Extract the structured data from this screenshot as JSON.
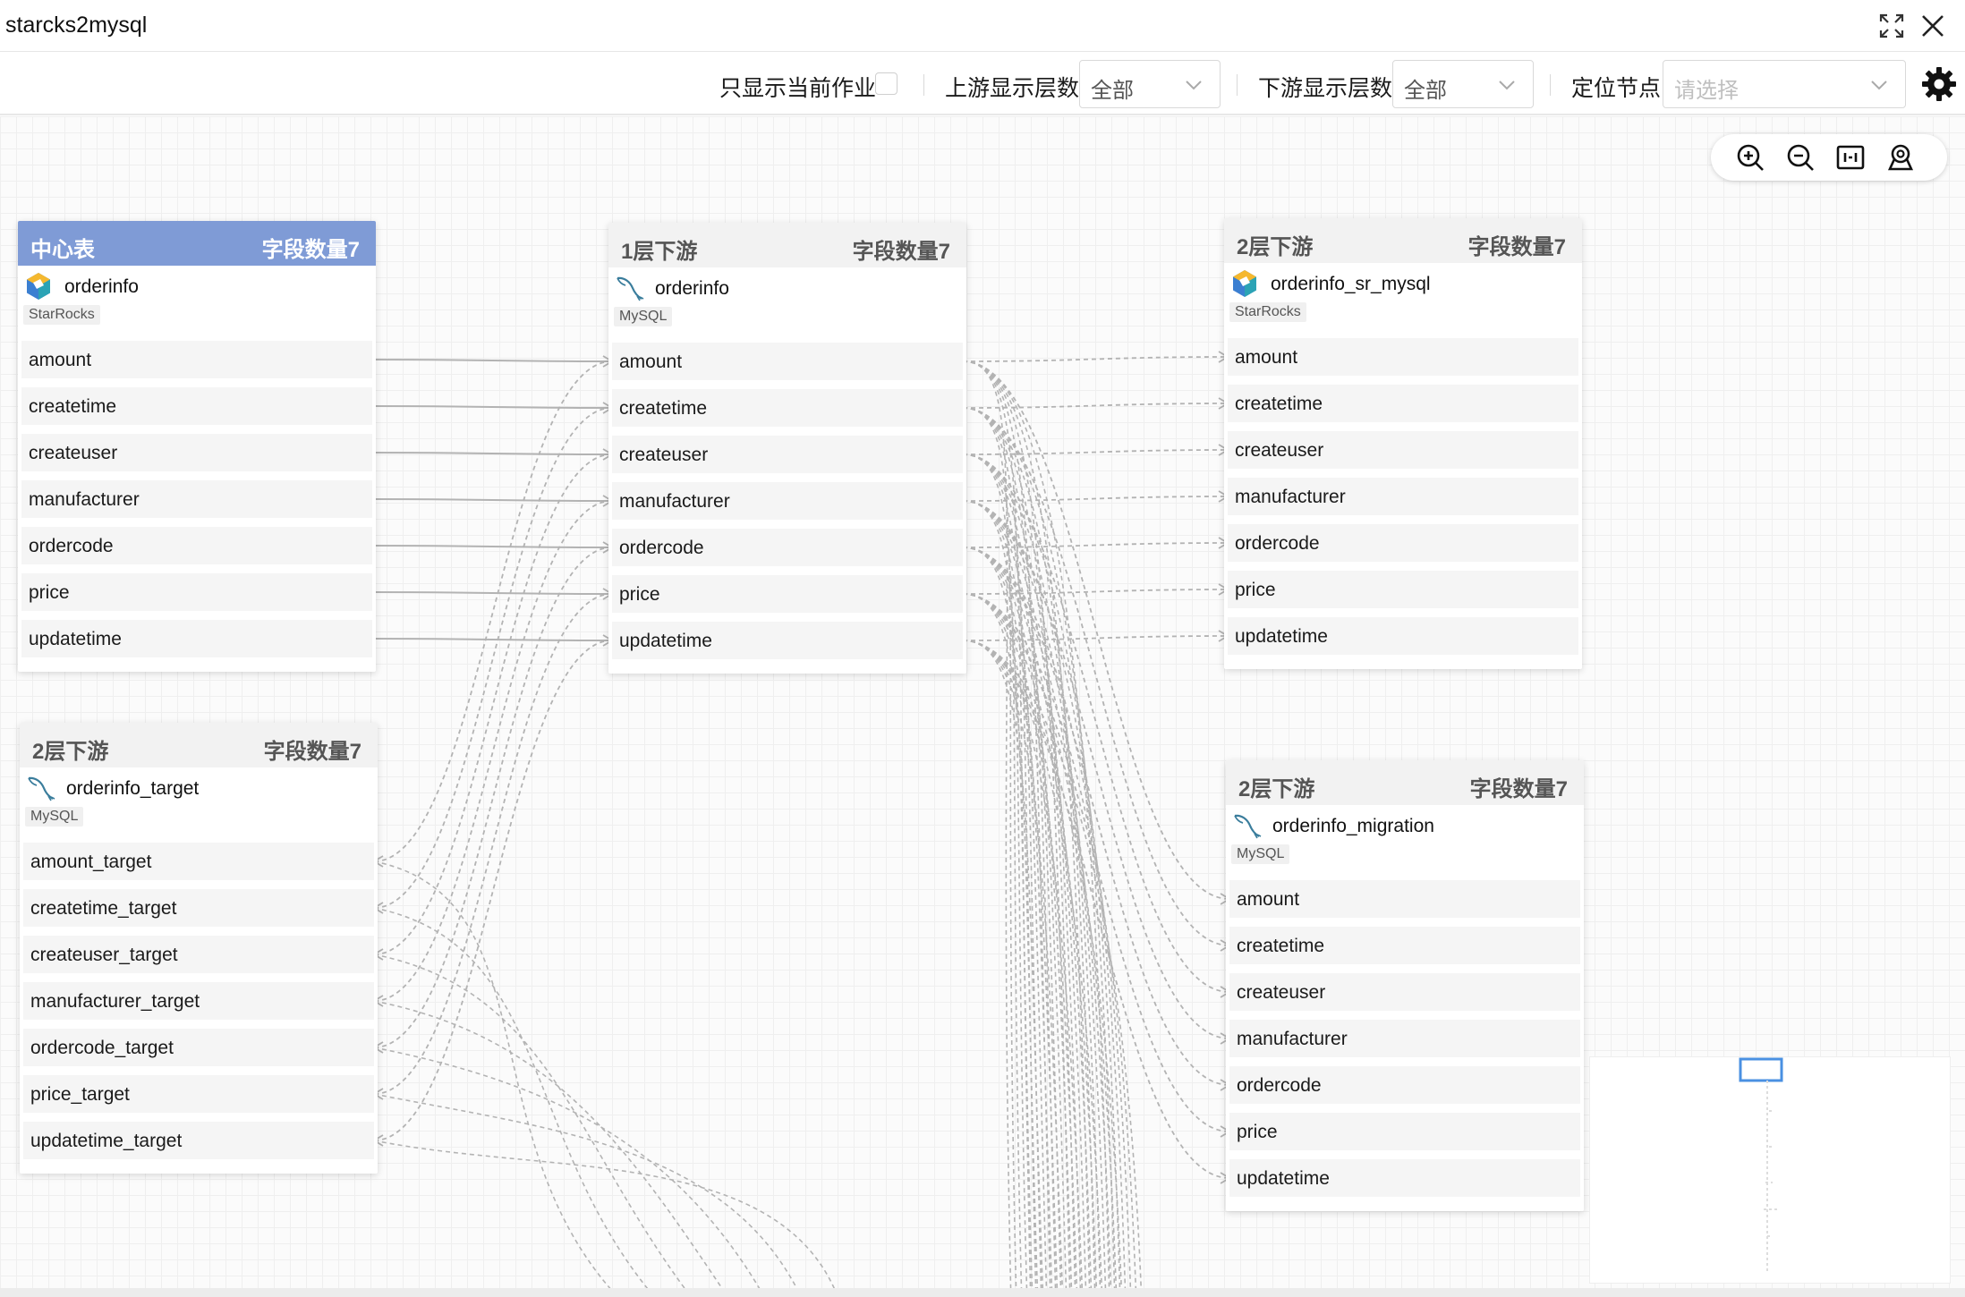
{
  "window": {
    "title": "starcks2mysql"
  },
  "toolbar": {
    "only_current_label": "只显示当前作业",
    "upstream_label": "上游显示层数",
    "upstream_value": "全部",
    "downstream_label": "下游显示层数",
    "downstream_value": "全部",
    "locate_label": "定位节点",
    "locate_placeholder": "请选择"
  },
  "icons": {
    "expand": "expand-icon",
    "close": "close-icon",
    "gear": "gear-icon",
    "zoom_in": "zoom-in-icon",
    "zoom_out": "zoom-out-icon",
    "fit": "fit-view-icon",
    "locate": "locate-icon",
    "starrocks": "starrocks-logo-icon",
    "mysql": "mysql-dolphin-icon"
  },
  "colors": {
    "center_header": "#7f9bd6",
    "edge": "#b3b3b3"
  },
  "nodes": {
    "center": {
      "level": "中心表",
      "count": "字段数量7",
      "table": "orderinfo",
      "db": "StarRocks",
      "fields": [
        "amount",
        "createtime",
        "createuser",
        "manufacturer",
        "ordercode",
        "price",
        "updatetime"
      ]
    },
    "l1": {
      "level": "1层下游",
      "count": "字段数量7",
      "table": "orderinfo",
      "db": "MySQL",
      "fields": [
        "amount",
        "createtime",
        "createuser",
        "manufacturer",
        "ordercode",
        "price",
        "updatetime"
      ]
    },
    "sr": {
      "level": "2层下游",
      "count": "字段数量7",
      "table": "orderinfo_sr_mysql",
      "db": "StarRocks",
      "fields": [
        "amount",
        "createtime",
        "createuser",
        "manufacturer",
        "ordercode",
        "price",
        "updatetime"
      ]
    },
    "target": {
      "level": "2层下游",
      "count": "字段数量7",
      "table": "orderinfo_target",
      "db": "MySQL",
      "fields": [
        "amount_target",
        "createtime_target",
        "createuser_target",
        "manufacturer_target",
        "ordercode_target",
        "price_target",
        "updatetime_target"
      ]
    },
    "migration": {
      "level": "2层下游",
      "count": "字段数量7",
      "table": "orderinfo_migration",
      "db": "MySQL",
      "fields": [
        "amount",
        "createtime",
        "createuser",
        "manufacturer",
        "ordercode",
        "price",
        "updatetime"
      ]
    }
  }
}
